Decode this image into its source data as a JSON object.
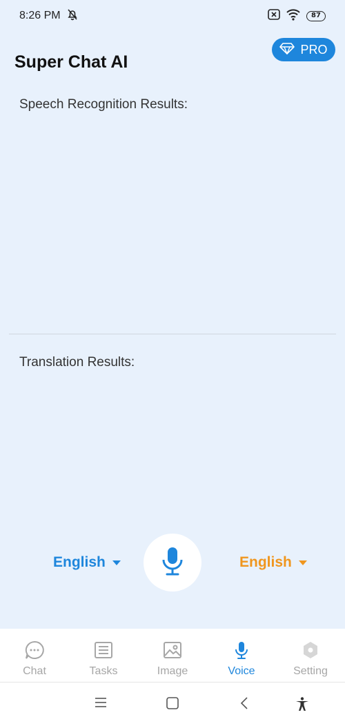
{
  "status_bar": {
    "time": "8:26 PM",
    "battery": "87",
    "icons": [
      "mute-icon",
      "sim-icon",
      "wifi-icon",
      "battery-icon"
    ]
  },
  "header": {
    "title": "Super Chat AI",
    "pro_label": "PRO"
  },
  "speech": {
    "label": "Speech Recognition Results:"
  },
  "translation": {
    "label": "Translation Results:"
  },
  "controls": {
    "source_language": "English",
    "target_language": "English"
  },
  "nav": {
    "items": [
      {
        "label": "Chat",
        "icon": "chat-bubble-icon"
      },
      {
        "label": "Tasks",
        "icon": "list-icon"
      },
      {
        "label": "Image",
        "icon": "image-icon"
      },
      {
        "label": "Voice",
        "icon": "microphone-icon",
        "active": true
      },
      {
        "label": "Setting",
        "icon": "gear-icon"
      }
    ]
  },
  "colors": {
    "background": "#e8f1fc",
    "accent_blue": "#1e86dc",
    "accent_orange": "#f0961e",
    "inactive": "#a6a6a6"
  }
}
